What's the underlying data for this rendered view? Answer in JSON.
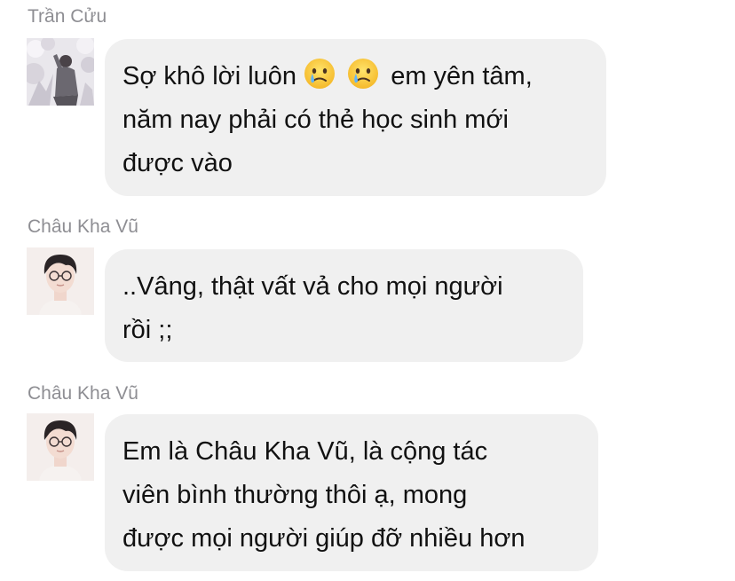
{
  "messages": [
    {
      "sender": "Trần Cửu",
      "avatar_icon": "person-photographing-blossoms-avatar-icon",
      "lines": [
        {
          "before": "Sợ khô lời luôn ",
          "emojis": [
            "crying-face-emoji-icon",
            "crying-face-emoji-icon"
          ],
          "after": " em yên tâm,"
        },
        "năm nay phải có thẻ học sinh mới",
        "được vào"
      ]
    },
    {
      "sender": "Châu Kha Vũ",
      "avatar_icon": "young-man-with-glasses-avatar-icon",
      "lines": [
        "..Vâng, thật vất vả cho mọi người",
        "rồi ;;"
      ]
    },
    {
      "sender": "Châu Kha Vũ",
      "avatar_icon": "young-man-with-glasses-avatar-icon",
      "lines": [
        "Em là Châu Kha Vũ, là cộng tác",
        "viên bình thường thôi ạ, mong",
        "được mọi người giúp đỡ nhiều hơn"
      ]
    }
  ],
  "colors": {
    "bubble_background": "#f0f0f0",
    "sender_name": "#8e8e93",
    "message_text": "#111111"
  }
}
